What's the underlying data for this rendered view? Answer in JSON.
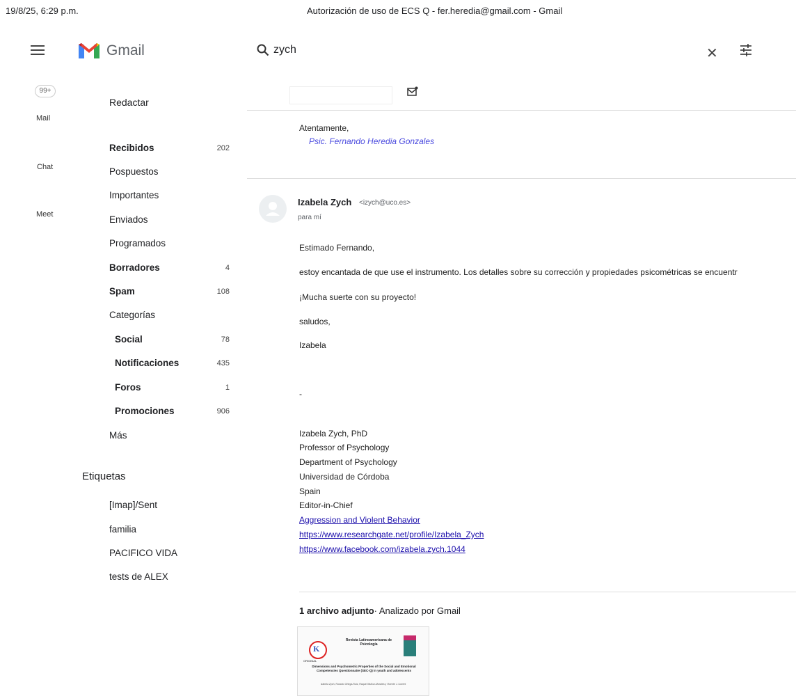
{
  "print_header": {
    "datetime": "19/8/25, 6:29 p.m.",
    "title": "Autorización de uso de ECS Q - fer.heredia@gmail.com - Gmail"
  },
  "app": {
    "name": "Gmail",
    "brand_colors": [
      "#EA4335",
      "#4285F4",
      "#34A853",
      "#FBBC04",
      "#C5221F"
    ]
  },
  "search": {
    "query": "zych"
  },
  "rail": {
    "badge": "99+",
    "mail": "Mail",
    "chat": "Chat",
    "meet": "Meet"
  },
  "nav": {
    "compose": "Redactar",
    "inbox": {
      "label": "Recibidos",
      "count": "202"
    },
    "snoozed": "Pospuestos",
    "important": "Importantes",
    "sent": "Enviados",
    "scheduled": "Programados",
    "drafts": {
      "label": "Borradores",
      "count": "4"
    },
    "spam": {
      "label": "Spam",
      "count": "108"
    },
    "categories": "Categorías",
    "social": {
      "label": "Social",
      "count": "78"
    },
    "updates": {
      "label": "Notificaciones",
      "count": "435"
    },
    "forums": {
      "label": "Foros",
      "count": "1"
    },
    "promotions": {
      "label": "Promociones",
      "count": "906"
    },
    "more": "Más",
    "labels_title": "Etiquetas",
    "labels": [
      "[Imap]/Sent",
      "familia",
      "PACIFICO VIDA",
      "tests de ALEX"
    ]
  },
  "previous_message": {
    "closing": "Atentamente,",
    "signature": "Psic. Fernando Heredia Gonzales"
  },
  "message": {
    "sender_name": "Izabela Zych",
    "sender_email": "<izych@uco.es>",
    "recipient": "para mí",
    "greeting": "Estimado Fernando,",
    "body1": "estoy encantada de que use el instrumento. Los detalles sobre su corrección y propiedades psicométricas se encuentr",
    "body2": "¡Mucha suerte con su proyecto!",
    "body3": "saludos,",
    "body4": "Izabela",
    "dash": "-",
    "sig": [
      "Izabela Zych, PhD",
      "Professor of Psychology",
      "Department of Psychology",
      "Universidad de Córdoba",
      "Spain",
      "Editor-in-Chief"
    ],
    "links": [
      "Aggression and Violent Behavior",
      "https://www.researchgate.net/profile/Izabela_Zych",
      "https://www.facebook.com/izabela.zych.1044"
    ]
  },
  "attachments": {
    "count_label": "1 archivo adjunto",
    "scan_label": "Analizado por Gmail",
    "thumb": {
      "journal": "Revista Latinoamericana de Psicología",
      "section": "ORIGINAL",
      "paper_title": "Dimensions and Psychometric Properties of the Social and Emotional Competencies Questionnaire (SEC-Q) in youth and adolescents",
      "authors": "Izabela Zych, Rosario Ortega-Ruiz, Raquel Muñoz-Morales y Vicente J. Llorent"
    }
  }
}
